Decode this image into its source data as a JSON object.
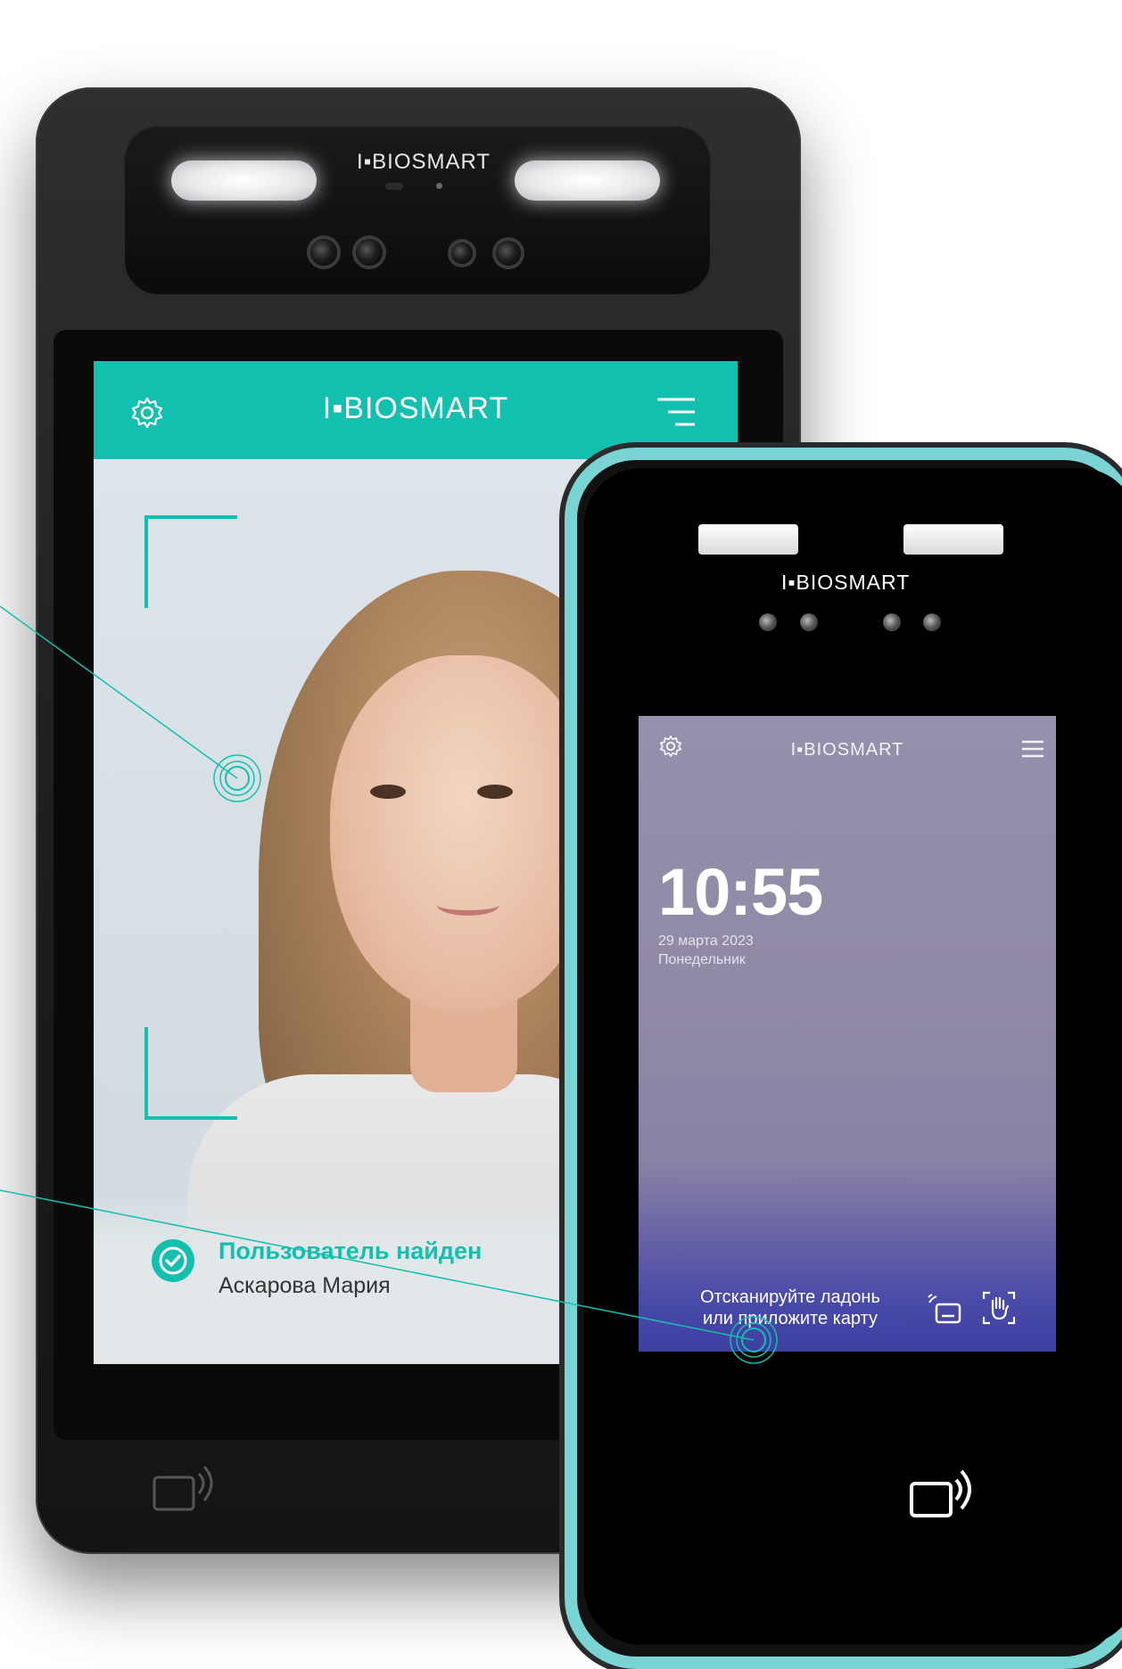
{
  "brand": {
    "name": "I▪BIOSMART",
    "accent_color": "#13bfae",
    "small_screen_gradient": [
      "#9690ad",
      "#3d3fa2"
    ]
  },
  "big_device": {
    "hardware_logo": "I▪BIOSMART",
    "screen": {
      "header": {
        "logo": "I▪BIOSMART",
        "settings_icon": "gear-icon",
        "menu_icon": "menu-icon"
      },
      "result": {
        "status_icon": "check-circle-icon",
        "title": "Пользователь найден",
        "name": "Аскарова Мария"
      }
    },
    "nfc_icon": "nfc-card-icon"
  },
  "small_device": {
    "hardware_logo": "I▪BIOSMART",
    "screen": {
      "header": {
        "logo": "I▪BIOSMART",
        "settings_icon": "gear-icon",
        "menu_icon": "menu-icon"
      },
      "time": "10:55",
      "date": "29 марта 2023",
      "weekday": "Понедельник",
      "prompt_line1": "Отсканируйте ладонь",
      "prompt_line2": "или приложите карту",
      "card_icon": "card-wireless-icon",
      "palm_icon": "palm-scan-icon"
    },
    "nfc_icon": "nfc-card-icon"
  }
}
